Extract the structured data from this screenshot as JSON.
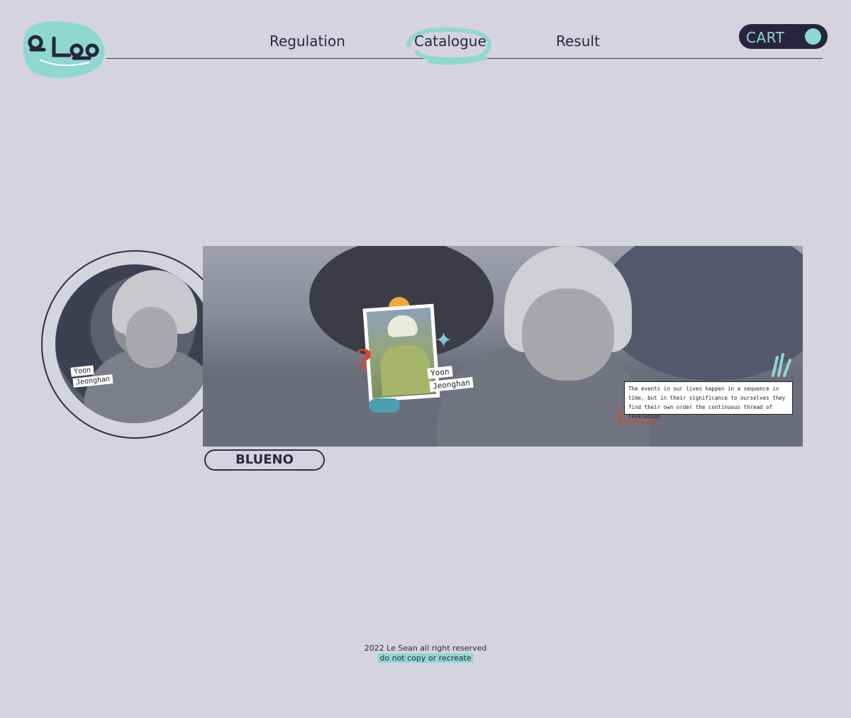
{
  "header": {
    "nav": [
      {
        "label": "Regulation"
      },
      {
        "label": "Catalogue"
      },
      {
        "label": "Result"
      }
    ],
    "cart_label": "CART",
    "accent_color": "#8fd8d0"
  },
  "portrait": {
    "tag_line1": "Yoon",
    "tag_line2": "Jeonghan"
  },
  "banner": {
    "polaroid_tag_line1": "Yoon",
    "polaroid_tag_line2": "Jeonghan",
    "quote": "The events in our lives happen in a sequence in time, but in their significance to ourselves they find their own order the continuous thread of revelation"
  },
  "product": {
    "label": "BLUENO"
  },
  "footer": {
    "copyright": "2022 Le Sean all right reserved",
    "notice": "do not copy or recreate"
  }
}
